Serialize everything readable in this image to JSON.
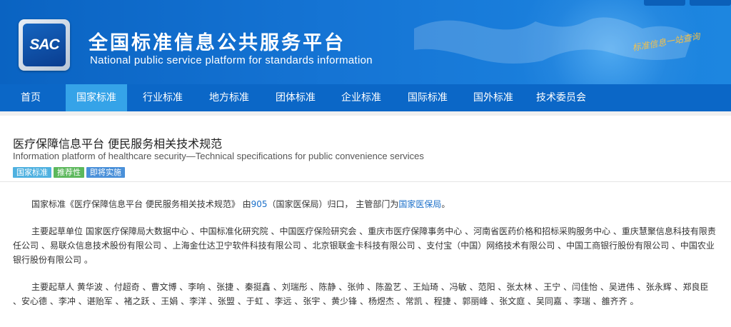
{
  "header": {
    "logo_text": "SAC",
    "title_cn": "全国标准信息公共服务平台",
    "title_en": "National public service platform  for standards information",
    "slogan": "标准信息一站查询"
  },
  "nav": {
    "items": [
      {
        "label": "首页",
        "active": false
      },
      {
        "label": "国家标准",
        "active": true
      },
      {
        "label": "行业标准",
        "active": false
      },
      {
        "label": "地方标准",
        "active": false
      },
      {
        "label": "团体标准",
        "active": false
      },
      {
        "label": "企业标准",
        "active": false
      },
      {
        "label": "国际标准",
        "active": false
      },
      {
        "label": "国外标准",
        "active": false
      },
      {
        "label": "技术委员会",
        "active": false
      }
    ]
  },
  "standard": {
    "title_cn": "医疗保障信息平台 便民服务相关技术规范",
    "title_en": "Information platform of healthcare security—Technical specifications for public convenience services",
    "tags": [
      {
        "label": "国家标准",
        "color": "#4fb1e0"
      },
      {
        "label": "推荐性",
        "color": "#5cb85c"
      },
      {
        "label": "即将实施",
        "color": "#4a90d9"
      }
    ]
  },
  "intro": {
    "prefix": "国家标准《医疗保障信息平台 便民服务相关技术规范》 由",
    "tc_code": "905",
    "middle": "（国家医保局）归口， 主管部门为",
    "authority": "国家医保局",
    "suffix": "。"
  },
  "drafting_units": {
    "label": "主要起草单位",
    "text": "国家医疗保障局大数据中心 、中国标准化研究院 、中国医疗保险研究会 、重庆市医疗保障事务中心 、河南省医药价格和招标采购服务中心 、重庆慧聚信息科技有限责任公司 、易联众信息技术股份有限公司 、上海金仕达卫宁软件科技有限公司 、北京银联金卡科技有限公司 、支付宝（中国）网络技术有限公司 、中国工商银行股份有限公司 、中国农业银行股份有限公司 。"
  },
  "drafters": {
    "label": "主要起草人",
    "text": "黄华波 、付超奇 、曹文博 、李响 、张捷 、秦挺鑫 、刘瑞彤 、陈静 、张帅 、陈盈艺 、王灿琦 、冯敏 、范阳 、张太林 、王宁 、闫佳怡 、吴进伟 、张永辉 、郑良臣 、安心德 、李冲 、谌贻军 、褚之跃 、王娟 、李洋 、张盟 、于虹 、李远 、张宇 、黄少锋 、杨煜杰 、常凯 、程捷 、郭丽峰 、张文庭 、吴同嘉 、李瑞 、雒齐齐 。"
  }
}
